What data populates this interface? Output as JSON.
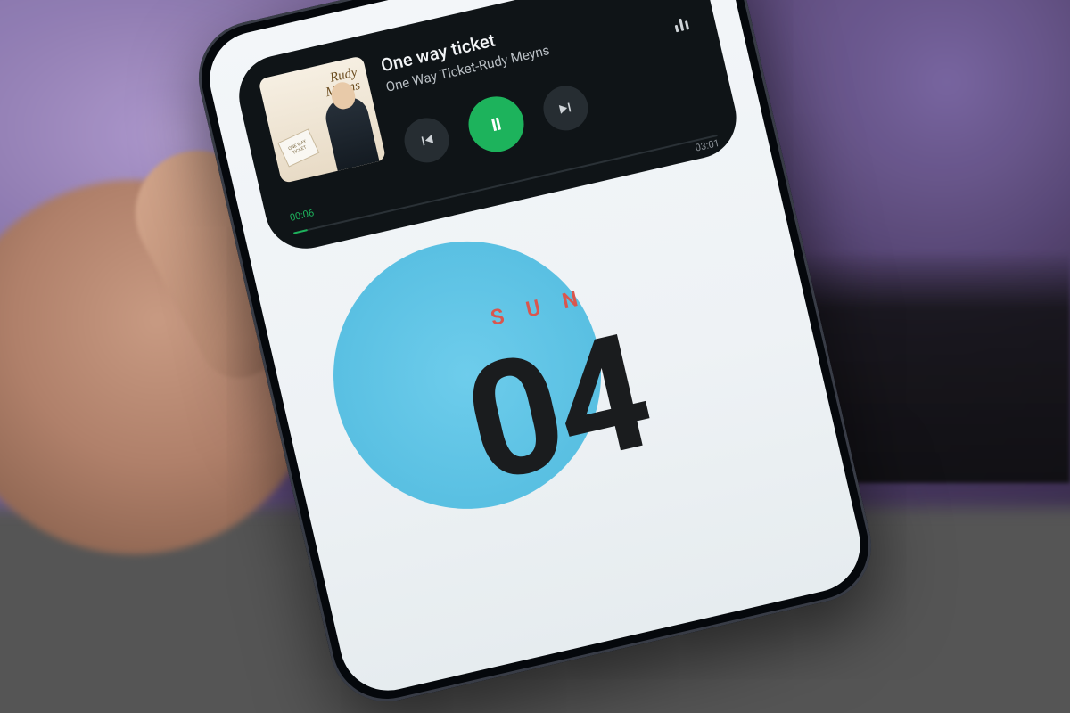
{
  "player": {
    "album": {
      "line1": "Rudy",
      "line2": "Meyns",
      "stamp": "ONE WAY TICKET"
    },
    "track_title": "One way ticket",
    "track_artist": "One Way Ticket-Rudy Meyns",
    "elapsed": "00:06",
    "total": "03:01",
    "progress_percent": 3.3
  },
  "lockscreen": {
    "day_of_week": "SUN",
    "day_number": "04"
  },
  "colors": {
    "accent_green": "#1db35c",
    "accent_blue": "#3fb7df",
    "dow_red": "#d9564e"
  }
}
